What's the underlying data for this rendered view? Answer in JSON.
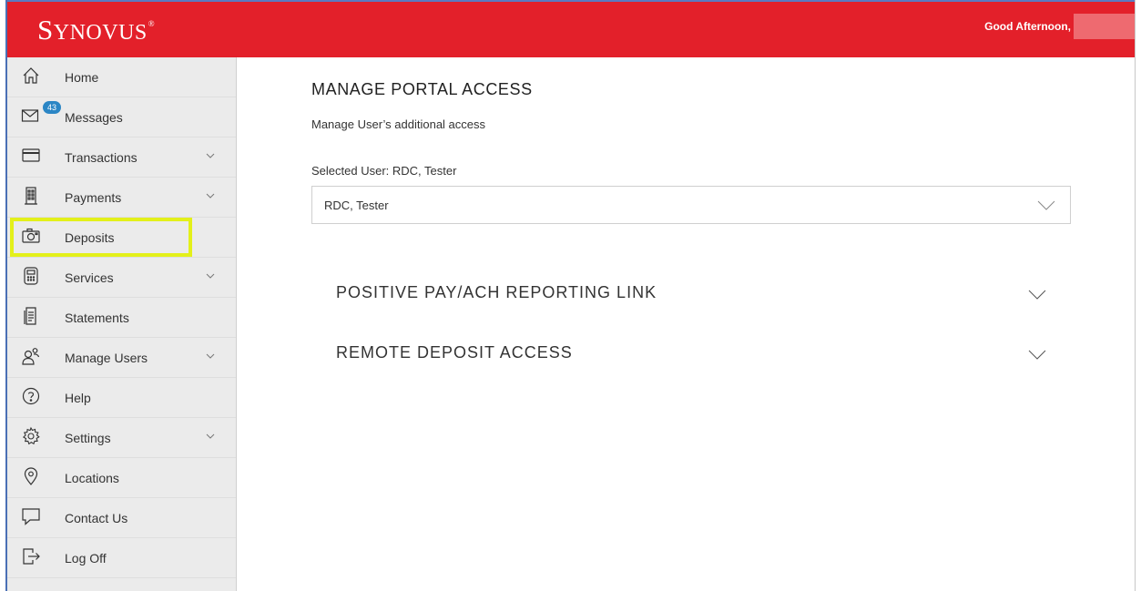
{
  "header": {
    "logo": {
      "first": "S",
      "rest": "YNOVUS",
      "mark": "®"
    },
    "greeting": "Good Afternoon,",
    "colors": {
      "brand_red": "#e3202a",
      "highlight": "#e3f01a",
      "badge": "#2b86c5"
    }
  },
  "sidebar": {
    "items": [
      {
        "label": "Home",
        "icon": "home-icon",
        "has_chevron": false
      },
      {
        "label": "Messages",
        "icon": "envelope-icon",
        "badge": "43",
        "has_chevron": false
      },
      {
        "label": "Transactions",
        "icon": "card-icon",
        "has_chevron": true
      },
      {
        "label": "Payments",
        "icon": "building-icon",
        "has_chevron": true
      },
      {
        "label": "Deposits",
        "icon": "camera-icon",
        "has_chevron": false,
        "highlighted": true
      },
      {
        "label": "Services",
        "icon": "calculator-icon",
        "has_chevron": true
      },
      {
        "label": "Statements",
        "icon": "document-icon",
        "has_chevron": false
      },
      {
        "label": "Manage Users",
        "icon": "users-icon",
        "has_chevron": true
      },
      {
        "label": "Help",
        "icon": "question-icon",
        "has_chevron": false
      },
      {
        "label": "Settings",
        "icon": "gear-icon",
        "has_chevron": true
      },
      {
        "label": "Locations",
        "icon": "location-pin-icon",
        "has_chevron": false
      },
      {
        "label": "Contact Us",
        "icon": "chat-bubble-icon",
        "has_chevron": false
      },
      {
        "label": "Log Off",
        "icon": "logout-icon",
        "has_chevron": false
      }
    ]
  },
  "main": {
    "title": "MANAGE PORTAL ACCESS",
    "subtitle": "Manage User’s additional access",
    "selected_user_label": "Selected User: RDC, Tester",
    "user_select_value": "RDC, Tester",
    "sections": [
      {
        "title": "POSITIVE PAY/ACH REPORTING LINK"
      },
      {
        "title": "REMOTE DEPOSIT ACCESS"
      }
    ]
  }
}
